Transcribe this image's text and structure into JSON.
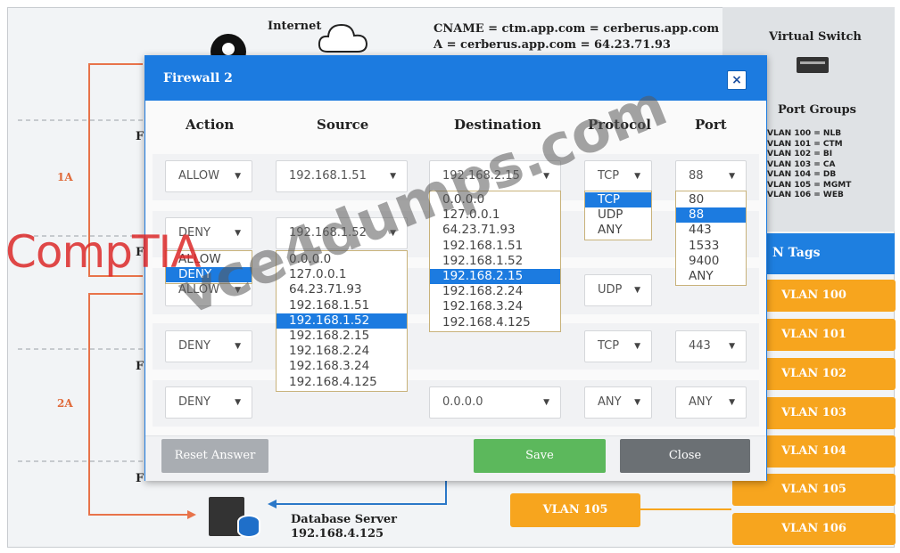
{
  "background": {
    "internet_label": "Internet",
    "dns_line1": "CNAME = ctm.app.com = cerberus.app.com",
    "dns_line2": "A = cerberus.app.com = 64.23.71.93",
    "virtual_switch_title": "Virtual Switch",
    "port_groups_title": "Port Groups",
    "port_groups": [
      "VLAN 100 = NLB",
      "VLAN 101 = CTM",
      "VLAN 102 = BI",
      "VLAN 103 = CA",
      "VLAN 104 = DB",
      "VLAN 105 = MGMT",
      "VLAN 106 = WEB"
    ],
    "vlan_tags_title": "N Tags",
    "vlan_tags": [
      "VLAN 100",
      "VLAN 101",
      "VLAN 102",
      "VLAN 103",
      "VLAN 104",
      "VLAN 105",
      "VLAN 106"
    ],
    "vlan_bottom": "VLAN 105",
    "label_1a": "1A",
    "label_2a": "2A",
    "db_name": "Database Server",
    "db_ip": "192.168.4.125",
    "fw_letter": "F",
    "fw_letter2": "F",
    "fw_letter3": "F",
    "fw_letter4": "F"
  },
  "dialog": {
    "title": "Firewall 2",
    "close_glyph": "×",
    "columns": {
      "action": "Action",
      "source": "Source",
      "destination": "Destination",
      "protocol": "Protocol",
      "port": "Port"
    },
    "rows": [
      {
        "action": "ALLOW",
        "source": "192.168.1.51",
        "destination": "192.168.2.15",
        "protocol": "TCP",
        "port": "88"
      },
      {
        "action": "DENY",
        "source": "192.168.1.52",
        "destination": "",
        "protocol": "",
        "port": ""
      },
      {
        "action": "ALLOW",
        "source": "",
        "destination": "",
        "protocol": "UDP",
        "port": ""
      },
      {
        "action": "DENY",
        "source": "",
        "destination": "",
        "protocol": "TCP",
        "port": "443"
      },
      {
        "action": "DENY",
        "source": "",
        "destination": "0.0.0.0",
        "protocol": "ANY",
        "port": "ANY"
      }
    ],
    "action_options": [
      "ALLOW",
      "DENY"
    ],
    "action_dropdown_selected": "DENY",
    "source_options": [
      "0.0.0.0",
      "127.0.0.1",
      "64.23.71.93",
      "192.168.1.51",
      "192.168.1.52",
      "192.168.2.15",
      "192.168.2.24",
      "192.168.3.24",
      "192.168.4.125"
    ],
    "source_dropdown_selected": "192.168.1.52",
    "destination_options": [
      "0.0.0.0",
      "127.0.0.1",
      "64.23.71.93",
      "192.168.1.51",
      "192.168.1.52",
      "192.168.2.15",
      "192.168.2.24",
      "192.168.3.24",
      "192.168.4.125"
    ],
    "destination_dropdown_selected": "192.168.2.15",
    "protocol_options": [
      "TCP",
      "UDP",
      "ANY"
    ],
    "protocol_dropdown_selected": "TCP",
    "port_options": [
      "80",
      "88",
      "443",
      "1533",
      "9400",
      "ANY"
    ],
    "port_dropdown_selected": "88",
    "buttons": {
      "reset": "Reset Answer",
      "save": "Save",
      "close": "Close"
    }
  },
  "watermarks": {
    "comptia": "CompTIA",
    "vce": "vce4dumps.com"
  },
  "colors": {
    "dialog_blue": "#1c7be0",
    "save_green": "#5cb85c",
    "close_gray": "#6b7074",
    "reset_gray": "#a9adb2",
    "vlan_orange": "#f7a51e",
    "arrow_orange": "#e8734a"
  }
}
